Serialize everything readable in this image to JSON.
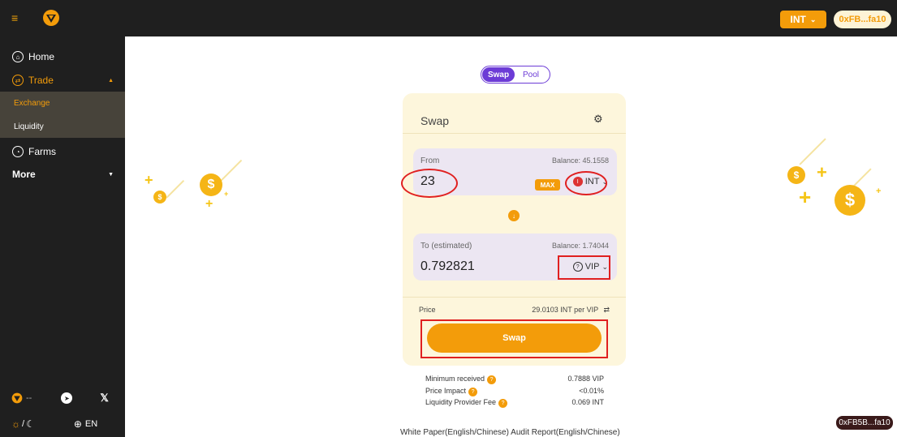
{
  "header": {
    "token_button": "INT",
    "address_button": "0xFB...fa10"
  },
  "sidebar": {
    "home": "Home",
    "trade": "Trade",
    "exchange": "Exchange",
    "liquidity": "Liquidity",
    "farms": "Farms",
    "more": "More",
    "token_price": "--",
    "language": "EN",
    "theme_sep": "/"
  },
  "toggle": {
    "swap": "Swap",
    "pool": "Pool"
  },
  "card": {
    "title": "Swap",
    "from": {
      "label": "From",
      "balance": "Balance: 45.1558",
      "value": "23",
      "max": "MAX",
      "token": "INT"
    },
    "to": {
      "label": "To (estimated)",
      "balance": "Balance: 1.74044",
      "value": "0.792821",
      "token": "VIP"
    },
    "price_label": "Price",
    "price_value": "29.0103 INT per VIP",
    "swap_button": "Swap"
  },
  "info": {
    "min_received_label": "Minimum received",
    "min_received_value": "0.7888 VIP",
    "price_impact_label": "Price Impact",
    "price_impact_value": "<0.01%",
    "fee_label": "Liquidity Provider Fee",
    "fee_value": "0.069 INT"
  },
  "footer": {
    "links": "White Paper(English/Chinese)  Audit Report(English/Chinese)"
  },
  "address_badge": "0xFB5B...fa10",
  "colors": {
    "accent": "#f39c0a",
    "purple": "#6c3bd6",
    "sidebar": "#1f1f1f"
  }
}
